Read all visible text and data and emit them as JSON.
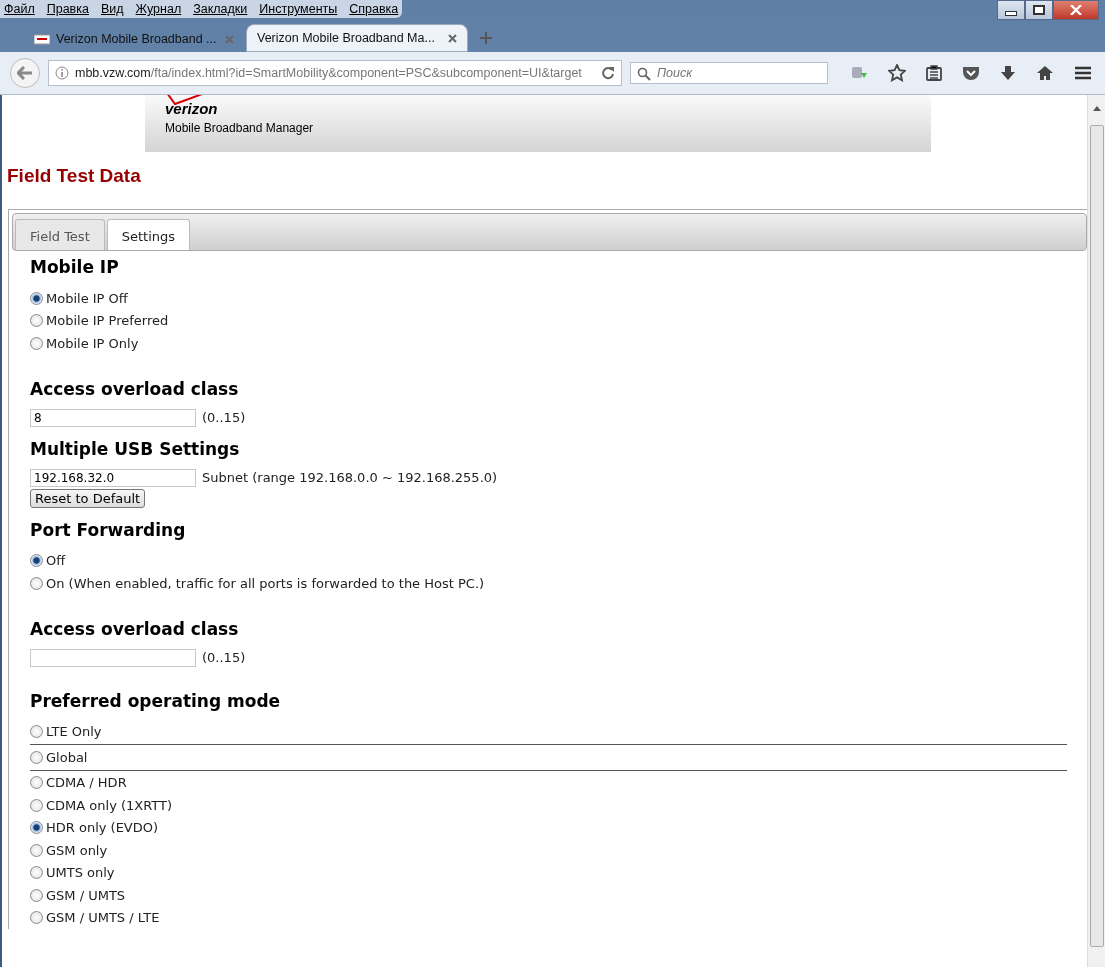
{
  "menu_bar": [
    "Файл",
    "Правка",
    "Вид",
    "Журнал",
    "Закладки",
    "Инструменты",
    "Справка"
  ],
  "browser_tabs": [
    {
      "title": "Verizon Mobile Broadband ...",
      "selected": false
    },
    {
      "title": "Verizon Mobile Broadband Ma...",
      "selected": true
    }
  ],
  "address_bar": {
    "host": "mbb.vzw.com",
    "path": "/fta/index.html?id=SmartMobility&component=PSC&subcomponent=UI&target"
  },
  "search": {
    "placeholder": "Поиск"
  },
  "banner": {
    "logo": "verizon",
    "subtitle": "Mobile Broadband Manager"
  },
  "page_title": "Field Test Data",
  "tabs": [
    {
      "label": "Field Test",
      "selected": false
    },
    {
      "label": "Settings",
      "selected": true
    }
  ],
  "sections": [
    {
      "heading": "Mobile IP",
      "items": [
        {
          "kind": "radio",
          "label": "Mobile IP Off",
          "selected": true
        },
        {
          "kind": "radio",
          "label": "Mobile IP Preferred",
          "selected": false
        },
        {
          "kind": "radio",
          "label": "Mobile IP Only",
          "selected": false
        }
      ]
    },
    {
      "heading": "Access overload class",
      "items": [
        {
          "kind": "input",
          "value": "8",
          "hint": "(0..15)"
        }
      ]
    },
    {
      "heading": "Multiple USB Settings",
      "items": [
        {
          "kind": "input",
          "value": "192.168.32.0",
          "hint": "Subnet (range 192.168.0.0 ~ 192.168.255.0)"
        },
        {
          "kind": "button",
          "label": "Reset to Default"
        }
      ]
    },
    {
      "heading": "Port Forwarding",
      "items": [
        {
          "kind": "radio",
          "label": "Off",
          "selected": true
        },
        {
          "kind": "radio",
          "label": "On (When enabled, traffic for all ports is forwarded to the Host PC.)",
          "selected": false
        }
      ]
    },
    {
      "heading": "Access overload class",
      "items": [
        {
          "kind": "input",
          "hint": "(0..15)"
        }
      ]
    },
    {
      "heading": "Preferred operating mode",
      "items": [
        {
          "kind": "radio",
          "label": "LTE Only",
          "selected": false,
          "rule_after": true
        },
        {
          "kind": "radio",
          "label": "Global",
          "selected": false,
          "rule_after": true
        },
        {
          "kind": "radio",
          "label": "CDMA / HDR",
          "selected": false
        },
        {
          "kind": "radio",
          "label": "CDMA only (1XRTT)",
          "selected": false
        },
        {
          "kind": "radio",
          "label": "HDR only (EVDO)",
          "selected": true
        },
        {
          "kind": "radio",
          "label": "GSM only",
          "selected": false
        },
        {
          "kind": "radio",
          "label": "UMTS only",
          "selected": false
        },
        {
          "kind": "radio",
          "label": "GSM / UMTS",
          "selected": false
        },
        {
          "kind": "radio",
          "label": "GSM / UMTS / LTE",
          "selected": false
        }
      ]
    }
  ]
}
